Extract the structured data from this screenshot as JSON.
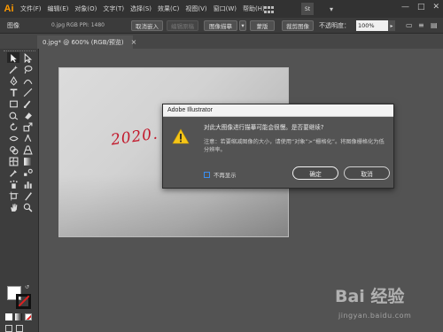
{
  "app": {
    "logo": "Ai",
    "accent": "#ff9a00"
  },
  "menu": [
    "文件(F)",
    "编辑(E)",
    "对象(O)",
    "文字(T)",
    "选择(S)",
    "效果(C)",
    "视图(V)",
    "窗口(W)",
    "帮助(H)"
  ],
  "menu_right": {
    "st_label": "St",
    "window_controls": [
      "—",
      "□",
      "✕"
    ]
  },
  "controlbar": {
    "object_label": "图像",
    "file_info": "0.jpg  RGB  PPI: 1480",
    "buttons": [
      "取消嵌入",
      "编辑原稿",
      "图像描摹",
      "蒙版",
      "裁剪图像"
    ],
    "opacity_label": "不透明度：",
    "opacity_value": "100%"
  },
  "tab": {
    "label": "0.jpg* @ 600% (RGB/预览)",
    "close": "×"
  },
  "canvas": {
    "handwriting": "2020."
  },
  "dialog": {
    "title": "Adobe Illustrator",
    "question": "对此大图像进行描摹可能会很慢。是否要继续?",
    "note": "注意：若要缩减图像的大小，请使用“对象”>“栅格化”。将图像栅格化为低分辨率。",
    "checkbox_label": "不再显示",
    "ok_label": "确定",
    "cancel_label": "取消"
  },
  "watermark": {
    "logo": "Bai 经验",
    "url": "jingyan.baidu.com"
  },
  "colors": {
    "dialog_bg": "#535353",
    "toolbar_bg": "#3d3d3d",
    "menubar_bg": "#323232",
    "handwriting": "#c2182b",
    "warning": "#f5c518"
  }
}
